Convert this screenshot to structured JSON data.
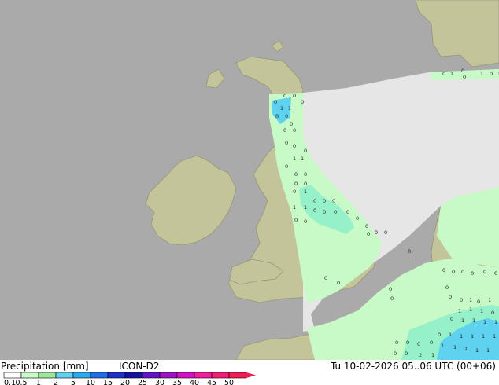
{
  "legend": {
    "title": "Precipitation [mm]",
    "model": "ICON-D2",
    "time": "Tu 10-02-2026 05..06 UTC (00+06)",
    "ticks": [
      "0.1",
      "0.5",
      "1",
      "2",
      "5",
      "10",
      "15",
      "20",
      "25",
      "30",
      "35",
      "40",
      "45",
      "50"
    ],
    "colors": [
      "#ffffff",
      "#c8fac8",
      "#9ae69a",
      "#5fd2f0",
      "#28aaf0",
      "#1e6ee6",
      "#1e32c8",
      "#1414a0",
      "#6414c8",
      "#a014c8",
      "#d214c8",
      "#f01ea0",
      "#f01e78",
      "#f01e50"
    ]
  },
  "map": {
    "colors": {
      "sea": "#aaaaaa",
      "land": "#c4c49a",
      "coast": "#969678",
      "no_data": "#e6e6e6",
      "light_precip": "#c8fac8",
      "moderate_precip": "#96f0c8",
      "heavy_precip": "#5fd2f0"
    },
    "markers": [
      "0",
      "1"
    ]
  }
}
